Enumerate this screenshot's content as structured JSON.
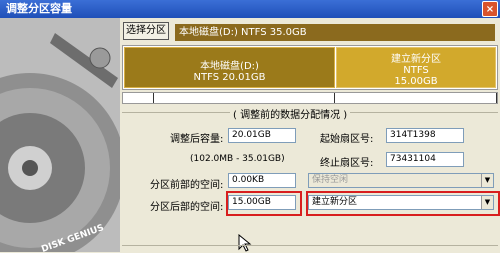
{
  "window": {
    "title": "调整分区容量",
    "close": "×"
  },
  "toolbar": {
    "select_partition_label": "选择分区"
  },
  "disk": {
    "info": "本地磁盘(D:) NTFS 35.0GB"
  },
  "partitions": [
    {
      "name": "本地磁盘(D:)",
      "fs": "NTFS 20.01GB"
    },
    {
      "name": "建立新分区",
      "fs": "NTFS",
      "size": "15.00GB"
    }
  ],
  "section": {
    "title": "( 调整前的数据分配情况 )"
  },
  "form": {
    "resized_size_label": "调整后容量:",
    "resized_size_value": "20.01GB",
    "range_text": "(102.0MB - 35.01GB)",
    "start_sector_label": "起始扇区号:",
    "start_sector_value": "314T1398",
    "end_sector_label": "终止扇区号:",
    "end_sector_value": "73431104",
    "space_before_label": "分区前部的空间:",
    "space_before_value": "0.00KB",
    "space_before_action": "保持空闲",
    "space_after_label": "分区后部的空间:",
    "space_after_value": "15.00GB",
    "space_after_action": "建立新分区"
  },
  "sidebar": {
    "brand": "DISK GENIUS"
  },
  "colors": {
    "highlight": "#d81e1e",
    "title_bar": "#2a5cc6",
    "partition_primary": "#9b7a1a",
    "partition_secondary": "#d2a92c"
  }
}
